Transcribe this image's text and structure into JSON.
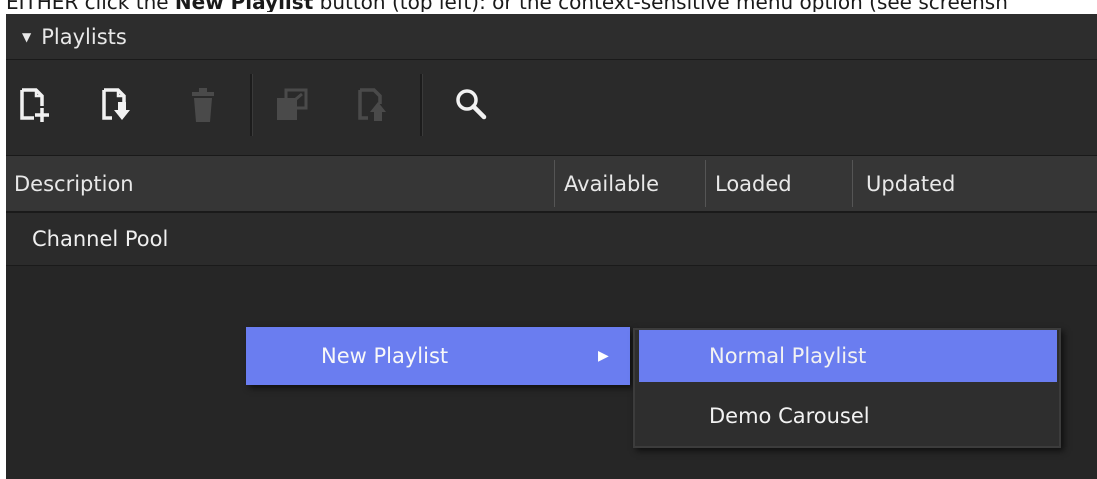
{
  "caption": {
    "prefix": "EITHER click the ",
    "bold": "New Playlist",
    "suffix": " button (top left): or the context-sensitive menu option (see screensh"
  },
  "panel": {
    "title": "Playlists",
    "collapse_icon": "triangle-down-icon"
  },
  "toolbar": {
    "buttons": [
      {
        "name": "new-playlist-button",
        "icon": "new-document-plus-icon",
        "enabled": true
      },
      {
        "name": "import-playlist-button",
        "icon": "document-import-icon",
        "enabled": true
      },
      {
        "name": "delete-button",
        "icon": "trash-icon",
        "enabled": false
      },
      {
        "name": "collapse-button",
        "icon": "window-collapse-icon",
        "enabled": false
      },
      {
        "name": "export-button",
        "icon": "document-export-icon",
        "enabled": false
      },
      {
        "name": "search-button",
        "icon": "search-icon",
        "enabled": true
      }
    ]
  },
  "table": {
    "columns": [
      "Description",
      "Available",
      "Loaded",
      "Updated"
    ],
    "rows": [
      {
        "description": "Channel Pool"
      }
    ]
  },
  "context_menu": {
    "item_label": "New Playlist",
    "submenu_arrow": "▶",
    "submenu": [
      "Normal Playlist",
      "Demo Carousel"
    ]
  },
  "colors": {
    "panel_bg": "#262626",
    "header_bg": "#363636",
    "highlight": "#6a7df0",
    "text": "#e8e8e8",
    "disabled_icon": "#555555"
  }
}
